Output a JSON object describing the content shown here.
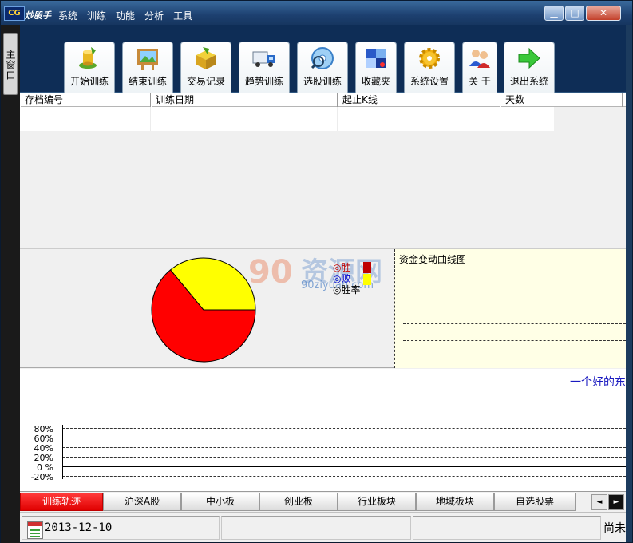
{
  "app": {
    "name": "炒股手",
    "logo_text": "CG"
  },
  "menu": [
    "系统",
    "训练",
    "功能",
    "分析",
    "工具"
  ],
  "window_controls": {
    "minimize": "▁",
    "maximize": "□",
    "close": "✕"
  },
  "side_tab": "主窗口",
  "toolbar": [
    {
      "label": "开始训练",
      "icon": "coins-icon"
    },
    {
      "label": "结束训练",
      "icon": "picture-icon"
    },
    {
      "label": "交易记录",
      "icon": "box-icon"
    },
    {
      "label": "趋势训练",
      "icon": "truck-icon"
    },
    {
      "label": "选股训练",
      "icon": "magnifier-disc-icon"
    },
    {
      "label": "收藏夹",
      "icon": "puzzle-icon"
    },
    {
      "label": "系统设置",
      "icon": "gear-icon"
    },
    {
      "label": "关 于",
      "icon": "people-icon"
    },
    {
      "label": "退出系统",
      "icon": "green-arrow-icon"
    }
  ],
  "grid": {
    "columns": [
      "存档编号",
      "训练日期",
      "起止K线",
      "天数"
    ]
  },
  "stats": {
    "pie": {
      "win_fraction": 0.36,
      "win_color": "#ffff00",
      "lose_color": "#ff0000"
    },
    "legend": {
      "win": "◎胜",
      "lose": "◎败",
      "rate": "◎胜率"
    },
    "watermark": "90ziyuan.com",
    "fund_chart_title": "资金变动曲线图"
  },
  "lower_chart": {
    "slogan": "一个好的东",
    "y_ticks": [
      "80%",
      "60%",
      "40%",
      "20%",
      "0 %",
      "-20%"
    ]
  },
  "tabs": [
    "训练轨迹",
    "沪深A股",
    "中小板",
    "创业板",
    "行业板块",
    "地域板块",
    "自选股票"
  ],
  "tab_scroll": {
    "left": "◄",
    "right": "►"
  },
  "status": {
    "date": "2013-12-10",
    "right": "尚未"
  },
  "colors": {
    "accent": "#e00000",
    "toolbar_bg": "#0e2d56",
    "fund_bg": "#ffffe6"
  }
}
